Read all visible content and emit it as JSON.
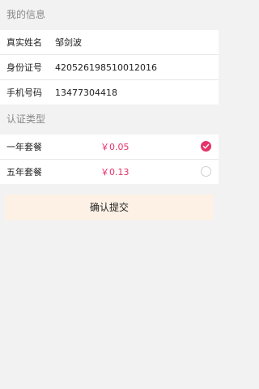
{
  "my_info": {
    "header": "我的信息",
    "rows": [
      {
        "label": "真实姓名",
        "value": "邹剑波"
      },
      {
        "label": "身份证号",
        "value": "420526198510012016"
      },
      {
        "label": "手机号码",
        "value": "13477304418"
      }
    ]
  },
  "cert_type": {
    "header": "认证类型",
    "plans": [
      {
        "name": "一年套餐",
        "price": "￥0.05",
        "selected": true
      },
      {
        "name": "五年套餐",
        "price": "￥0.13",
        "selected": false
      }
    ]
  },
  "submit": {
    "label": "确认提交"
  },
  "colors": {
    "accent": "#e5336a",
    "submit_bg": "#fdf1e6",
    "page_bg": "#f2f2f2"
  }
}
